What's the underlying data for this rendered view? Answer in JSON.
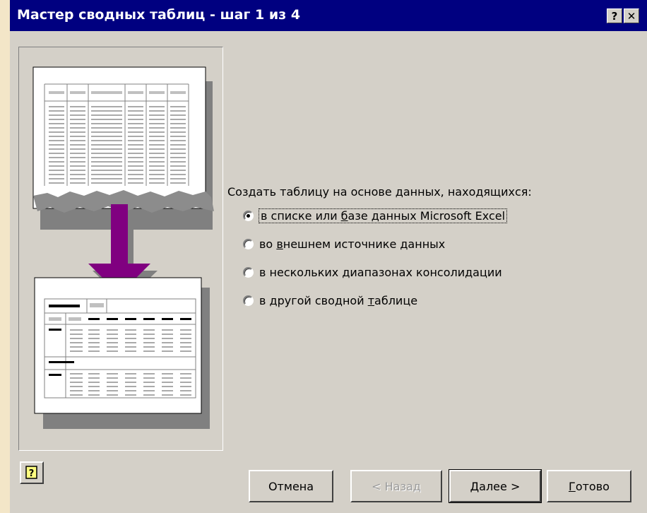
{
  "window": {
    "title": "Мастер сводных таблиц - шаг 1 из 4",
    "help_glyph": "?",
    "close_glyph": "✕"
  },
  "source": {
    "prompt": "Создать таблицу на основе данных, находящихся:",
    "options": [
      {
        "pre": "в списке или ",
        "ul": "б",
        "post": "азе данных Microsoft Excel",
        "checked": true
      },
      {
        "pre": "во ",
        "ul": "в",
        "post": "нешнем источнике данных",
        "checked": false
      },
      {
        "pre": "в нескольких ",
        "ul": "д",
        "post": "иапазонах консолидации",
        "checked": false
      },
      {
        "pre": "в другой сводной ",
        "ul": "т",
        "post": "аблице",
        "checked": false
      }
    ]
  },
  "footer": {
    "cancel": "Отмена",
    "back": "< Назад",
    "next": "Далее >",
    "finish_ul": "Г",
    "finish_rest": "отово"
  },
  "colors": {
    "titlebar": "#000080",
    "dialog": "#d4d0c8",
    "arrow": "#800080"
  },
  "icons": {
    "help": "help-icon",
    "illustration": "list-to-pivot-illustration"
  }
}
